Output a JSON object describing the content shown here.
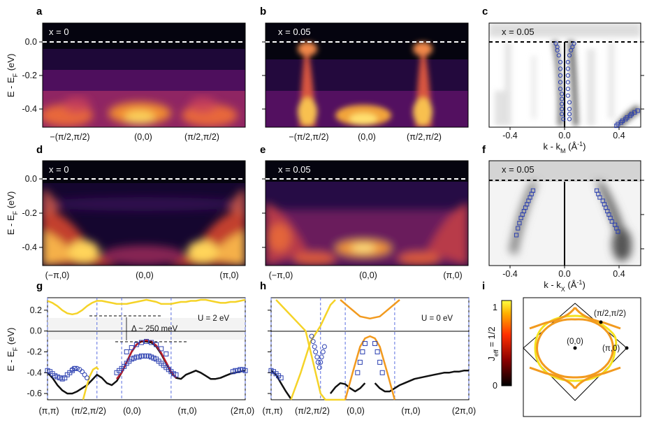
{
  "figure": {
    "panel_letters": [
      "a",
      "b",
      "c",
      "d",
      "e",
      "f",
      "g",
      "h",
      "i"
    ]
  },
  "chart_data": [
    {
      "panel": "a",
      "type": "heatmap",
      "annotation": "x = 0",
      "ylabel": "E - E_F (eV)",
      "ylim": [
        -0.52,
        0.1
      ],
      "yticks": [
        "0.0",
        "-0.2",
        "-0.4"
      ],
      "xticks": [
        "−(π/2,π/2)",
        "(0,0)",
        "(π/2,π/2)"
      ],
      "fermi_line": 0.0,
      "colormap": "inferno"
    },
    {
      "panel": "b",
      "type": "heatmap",
      "annotation": "x = 0.05",
      "ylim": [
        -0.52,
        0.1
      ],
      "xticks": [
        "−(π/2,π/2)",
        "(0,0)",
        "(π/2,π/2)"
      ],
      "fermi_line": 0.0,
      "colormap": "inferno"
    },
    {
      "panel": "c",
      "type": "heatmap",
      "annotation": "x = 0.05",
      "xlabel": "k - k_M (Å^-1)",
      "xlim": [
        -0.5,
        0.5
      ],
      "xticks": [
        "-0.4",
        "0.0",
        "0.4"
      ],
      "colormap": "greys",
      "markers": [
        {
          "symbol": "circle",
          "x": [
            -0.06,
            -0.05,
            -0.05,
            -0.04,
            -0.03,
            -0.03,
            -0.03,
            -0.03,
            -0.03,
            -0.02,
            -0.02,
            -0.02,
            -0.02,
            -0.02,
            -0.01
          ],
          "y": [
            -0.01,
            -0.03,
            -0.05,
            -0.08,
            -0.12,
            -0.16,
            -0.2,
            -0.24,
            -0.28,
            -0.31,
            -0.34,
            -0.37,
            -0.4,
            -0.43,
            -0.46
          ]
        },
        {
          "symbol": "circle",
          "x": [
            0.06,
            0.05,
            0.04,
            0.03,
            0.02,
            0.02,
            0.02,
            0.02,
            0.02,
            0.02,
            0.03,
            0.03,
            0.03,
            0.03
          ],
          "y": [
            -0.01,
            -0.03,
            -0.05,
            -0.08,
            -0.12,
            -0.16,
            -0.2,
            -0.24,
            -0.28,
            -0.32,
            -0.36,
            -0.4,
            -0.43,
            -0.46
          ]
        },
        {
          "symbol": "square",
          "x": [
            0.34,
            0.35,
            0.37,
            0.38,
            0.4,
            0.41,
            0.43,
            0.44,
            0.46,
            0.48
          ],
          "y": [
            -0.5,
            -0.49,
            -0.48,
            -0.47,
            -0.46,
            -0.45,
            -0.44,
            -0.43,
            -0.42,
            -0.41
          ]
        }
      ]
    },
    {
      "panel": "d",
      "type": "heatmap",
      "annotation": "x = 0",
      "ylabel": "E - E_F (eV)",
      "ylim": [
        -0.52,
        0.1
      ],
      "yticks": [
        "0.0",
        "-0.2",
        "-0.4"
      ],
      "xticks": [
        "(−π,0)",
        "(0,0)",
        "(π,0)"
      ],
      "fermi_line": 0.0,
      "colormap": "inferno"
    },
    {
      "panel": "e",
      "type": "heatmap",
      "annotation": "x = 0.05",
      "ylim": [
        -0.52,
        0.1
      ],
      "xticks": [
        "(−π,0)",
        "(0,0)",
        "(π,0)"
      ],
      "fermi_line": 0.0,
      "colormap": "inferno"
    },
    {
      "panel": "f",
      "type": "heatmap",
      "annotation": "x = 0.05",
      "xlabel": "k - k_X (Å^-1)",
      "xlim": [
        -0.5,
        0.5
      ],
      "xticks": [
        "-0.4",
        "0.0",
        "0.4"
      ],
      "colormap": "greys",
      "markers": [
        {
          "symbol": "square",
          "x": [
            -0.21,
            -0.22,
            -0.23,
            -0.24,
            -0.25,
            -0.26,
            -0.27,
            -0.28,
            -0.29,
            -0.3,
            -0.31,
            -0.32
          ],
          "y": [
            -0.06,
            -0.08,
            -0.1,
            -0.12,
            -0.14,
            -0.16,
            -0.18,
            -0.2,
            -0.22,
            -0.25,
            -0.28,
            -0.32
          ]
        },
        {
          "symbol": "square",
          "x": [
            0.21,
            0.22,
            0.23,
            0.25,
            0.26,
            0.27,
            0.28,
            0.29,
            0.3,
            0.31,
            0.33,
            0.34,
            0.35
          ],
          "y": [
            -0.06,
            -0.08,
            -0.1,
            -0.12,
            -0.14,
            -0.16,
            -0.18,
            -0.2,
            -0.22,
            -0.24,
            -0.26,
            -0.28,
            -0.3
          ]
        }
      ]
    },
    {
      "panel": "g",
      "type": "line",
      "ylabel": "E - E_F (eV)",
      "ylim": [
        -0.66,
        0.32
      ],
      "yticks": [
        "0.2",
        "0.0",
        "-0.2",
        "-0.4",
        "-0.6"
      ],
      "xticks": [
        "(π,π)",
        "(π/2,π/2)",
        "(0,0)",
        "(π,0)",
        "(2π,0)"
      ],
      "annotations": [
        "U = 2 eV",
        "Δ ~ 250 meV"
      ],
      "series": [
        {
          "color": "#f5d328",
          "x": [
            0,
            0.1,
            0.2,
            0.3,
            0.4,
            0.5,
            0.6,
            0.7,
            0.8,
            0.9,
            1,
            1.1,
            1.2,
            1.3,
            1.4,
            1.5,
            1.6,
            1.7,
            1.8,
            1.9,
            2,
            2.1,
            2.2,
            2.3,
            2.4,
            2.5,
            2.6,
            2.7,
            2.8,
            2.9,
            3,
            3.1,
            3.2,
            3.3,
            3.4,
            3.5,
            3.6,
            3.7,
            3.8,
            3.9,
            4
          ],
          "y": [
            0.29,
            0.27,
            0.24,
            0.2,
            0.17,
            0.16,
            0.17,
            0.2,
            0.24,
            0.27,
            0.29,
            0.29,
            0.28,
            0.27,
            0.26,
            0.26,
            0.26,
            0.27,
            0.28,
            0.29,
            0.3,
            0.29,
            0.28,
            0.26,
            0.26,
            0.26,
            0.27,
            0.28,
            0.28,
            0.29,
            0.29,
            0.3,
            0.3,
            0.29,
            0.28,
            0.27,
            0.27,
            0.28,
            0.28,
            0.29,
            0.3
          ]
        },
        {
          "color": "#111111",
          "x": [
            0,
            0.1,
            0.2,
            0.3,
            0.4,
            0.5,
            0.6,
            0.7,
            0.8,
            0.9,
            1,
            1.1,
            1.2,
            1.3,
            1.4,
            1.5,
            1.6,
            1.7,
            1.8,
            1.9,
            2,
            2.1,
            2.2,
            2.3,
            2.4,
            2.5,
            2.6,
            2.7,
            2.8,
            2.9,
            3,
            3.1,
            3.2,
            3.3,
            3.4,
            3.5,
            3.6,
            3.7,
            3.8,
            3.9,
            4
          ],
          "y": [
            -0.4,
            -0.45,
            -0.52,
            -0.57,
            -0.6,
            -0.6,
            -0.58,
            -0.55,
            -0.52,
            -0.47,
            -0.42,
            -0.45,
            -0.5,
            -0.52,
            -0.48,
            -0.4,
            -0.3,
            -0.2,
            -0.13,
            -0.1,
            -0.1,
            -0.11,
            -0.15,
            -0.22,
            -0.31,
            -0.4,
            -0.45,
            -0.46,
            -0.42,
            -0.4,
            -0.38,
            -0.4,
            -0.43,
            -0.46,
            -0.46,
            -0.45,
            -0.43,
            -0.41,
            -0.4,
            -0.39,
            -0.38
          ]
        },
        {
          "color": "#b71c2a",
          "x": [
            1.4,
            1.5,
            1.6,
            1.7,
            1.8,
            1.9,
            2,
            2.1,
            2.2,
            2.3,
            2.4,
            2.5,
            2.6
          ],
          "y": [
            -0.46,
            -0.4,
            -0.3,
            -0.2,
            -0.13,
            -0.1,
            -0.09,
            -0.1,
            -0.14,
            -0.21,
            -0.3,
            -0.39,
            -0.45
          ]
        },
        {
          "color": "#f5d328",
          "x": [
            0.72,
            0.78,
            0.85,
            0.92,
            0.99,
            1.03
          ],
          "y": [
            -0.66,
            -0.55,
            -0.44,
            -0.37,
            -0.35,
            -0.37
          ]
        }
      ],
      "markers": [
        {
          "symbol": "square",
          "x": [
            0,
            0.05,
            0.1,
            0.15,
            0.2,
            0.25,
            0.3,
            0.35,
            0.4,
            0.45,
            0.5,
            0.55
          ],
          "y": [
            -0.38,
            -0.39,
            -0.41,
            -0.43,
            -0.44,
            -0.45,
            -0.46,
            -0.45,
            -0.42,
            -0.4,
            -0.38,
            -0.36
          ]
        },
        {
          "symbol": "circle",
          "x": [
            0.5,
            0.55,
            0.6,
            0.65,
            0.7,
            0.75,
            0.8
          ],
          "y": [
            -0.37,
            -0.36,
            -0.36,
            -0.37,
            -0.39,
            -0.42,
            -0.45
          ]
        },
        {
          "symbol": "square",
          "x": [
            1.4,
            1.45,
            1.5,
            1.55,
            1.6,
            1.65,
            1.7,
            1.75,
            1.8,
            1.85,
            1.9,
            1.95,
            2,
            2.05,
            2.1,
            2.15,
            2.2,
            2.25,
            2.3,
            2.35,
            2.4,
            2.45,
            2.5,
            2.55,
            2.6
          ],
          "y": [
            -0.4,
            -0.38,
            -0.36,
            -0.34,
            -0.31,
            -0.29,
            -0.27,
            -0.26,
            -0.25,
            -0.25,
            -0.24,
            -0.24,
            -0.24,
            -0.24,
            -0.25,
            -0.26,
            -0.27,
            -0.29,
            -0.31,
            -0.33,
            -0.35,
            -0.37,
            -0.39,
            -0.41,
            -0.42
          ]
        },
        {
          "symbol": "square",
          "x": [
            1.6,
            1.7,
            1.8,
            1.9,
            2,
            2.1,
            2.2,
            2.3,
            2.4
          ],
          "y": [
            -0.2,
            -0.16,
            -0.13,
            -0.11,
            -0.1,
            -0.11,
            -0.13,
            -0.17,
            -0.22
          ]
        },
        {
          "symbol": "square",
          "x": [
            3.75,
            3.8,
            3.85,
            3.9,
            3.95,
            4
          ],
          "y": [
            -0.39,
            -0.38,
            -0.38,
            -0.37,
            -0.37,
            -0.38
          ]
        }
      ]
    },
    {
      "panel": "h",
      "type": "line",
      "ylim": [
        -0.66,
        0.32
      ],
      "xticks": [
        "(π,π)",
        "(π/2,π/2)",
        "(0,0)",
        "(π,0)",
        "(2π,0)"
      ],
      "annotations": [
        "U = 0 eV"
      ],
      "series": [
        {
          "color": "#111111",
          "x": [
            0,
            0.1,
            0.2,
            0.3,
            0.4
          ],
          "y": [
            -0.38,
            -0.42,
            -0.5,
            -0.58,
            -0.65
          ]
        },
        {
          "color": "#111111",
          "x": [
            1.2,
            1.3,
            1.4,
            1.5,
            1.6,
            1.7,
            1.8,
            1.9
          ],
          "y": [
            -0.6,
            -0.54,
            -0.5,
            -0.51,
            -0.55,
            -0.58,
            -0.55,
            -0.5
          ]
        },
        {
          "color": "#111111",
          "x": [
            2.1,
            2.2,
            2.3,
            2.4,
            2.5,
            2.6,
            2.7,
            2.8,
            2.9,
            3,
            3.1,
            3.2,
            3.3,
            3.4,
            3.5,
            3.6,
            3.7,
            3.8,
            3.9,
            4
          ],
          "y": [
            -0.5,
            -0.55,
            -0.58,
            -0.58,
            -0.55,
            -0.52,
            -0.5,
            -0.48,
            -0.46,
            -0.45,
            -0.44,
            -0.43,
            -0.42,
            -0.41,
            -0.4,
            -0.4,
            -0.39,
            -0.39,
            -0.38,
            -0.38
          ]
        },
        {
          "color": "#f5d328",
          "x": [
            0.1,
            0.3,
            0.5,
            0.7,
            0.8,
            0.9,
            1,
            1.1,
            1.3,
            1.5
          ],
          "y": [
            0.3,
            0.2,
            0.1,
            0,
            -0.2,
            -0.4,
            -0.6,
            -0.66,
            -0.66,
            -0.66
          ]
        },
        {
          "color": "#f5d328",
          "x": [
            0.4,
            0.6,
            0.8,
            1,
            1.1,
            1.2,
            1.3
          ],
          "y": [
            -0.66,
            -0.4,
            -0.1,
            0.05,
            0.15,
            0.25,
            0.3
          ]
        },
        {
          "color": "#f29a1e",
          "x": [
            1.4,
            1.6,
            1.8,
            2,
            2.2,
            2.4,
            2.6
          ],
          "y": [
            0.3,
            0.22,
            0.14,
            0.12,
            0.14,
            0.22,
            0.3
          ]
        },
        {
          "color": "#f29a1e",
          "x": [
            1.5,
            1.65,
            1.8,
            1.9,
            2,
            2.1,
            2.2,
            2.35,
            2.5
          ],
          "y": [
            -0.66,
            -0.4,
            -0.15,
            -0.07,
            -0.05,
            -0.07,
            -0.15,
            -0.4,
            -0.66
          ]
        }
      ],
      "markers": [
        {
          "symbol": "square",
          "x": [
            0,
            0.05,
            0.1,
            0.15,
            0.2
          ],
          "y": [
            -0.38,
            -0.39,
            -0.41,
            -0.43,
            -0.45
          ]
        },
        {
          "symbol": "circle",
          "x": [
            0.82,
            0.85,
            0.88,
            0.9,
            0.93,
            0.95,
            0.98,
            1,
            1.02,
            1.05,
            1.08
          ],
          "y": [
            -0.05,
            -0.1,
            -0.15,
            -0.2,
            -0.25,
            -0.3,
            -0.35,
            -0.3,
            -0.25,
            -0.2,
            -0.15
          ]
        },
        {
          "symbol": "square",
          "x": [
            1.75,
            1.8,
            1.85,
            1.9,
            2.1,
            2.15,
            2.2,
            2.25
          ],
          "y": [
            -0.4,
            -0.3,
            -0.2,
            -0.12,
            -0.12,
            -0.2,
            -0.3,
            -0.4
          ]
        }
      ]
    },
    {
      "panel": "i",
      "type": "other",
      "colorbar_label": "J_eff = 1/2",
      "colorbar_ticks": [
        "1",
        "0"
      ],
      "points": [
        "(0,0)",
        "(π/2,π/2)",
        "(π,0)"
      ]
    }
  ]
}
